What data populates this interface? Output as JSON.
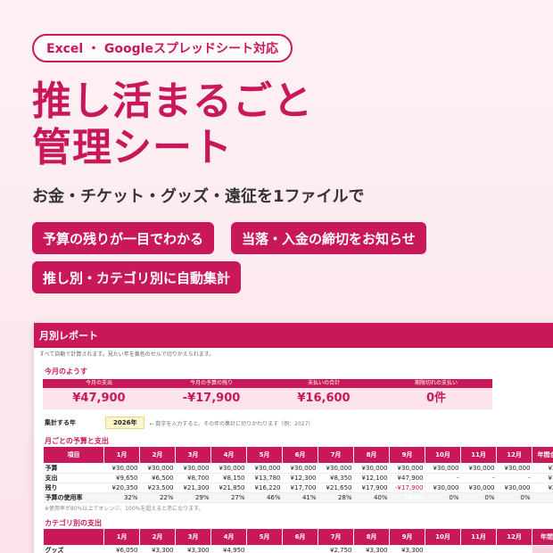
{
  "badge": "Excel ・ Googleスプレッドシート対応",
  "title_lines": [
    "推し活まるごと",
    "管理シート"
  ],
  "subtitle": "お金・チケット・グッズ・遠征を1ファイルで",
  "features": [
    "予算の残りが一目でわかる",
    "当落・入金の締切をお知らせ",
    "推し別・カテゴリ別に自動集計"
  ],
  "sheet": {
    "title": "月別レポート",
    "note": "すべて自動で計算されます。見たい年を黄色のセルで切りかえられます。",
    "summary_title": "今月のようす",
    "summary": [
      {
        "label": "今月の支出",
        "value": "¥47,900"
      },
      {
        "label": "今月の予算の残り",
        "value": "-¥17,900"
      },
      {
        "label": "未払いの合計",
        "value": "¥16,600"
      },
      {
        "label": "期限切れの支払い",
        "value": "0件"
      }
    ],
    "year_label": "集計する年",
    "year_value": "2026年",
    "year_hint": "← 数字を入力すると、その年の集計に切りかわります（例：2027）",
    "monthly_title": "月ごとの予算と支出",
    "monthly_headers": [
      "項目",
      "1月",
      "2月",
      "3月",
      "4月",
      "5月",
      "6月",
      "7月",
      "8月",
      "9月",
      "10月",
      "11月",
      "12月",
      "年間合計"
    ],
    "monthly_rows": [
      [
        "予算",
        "¥30,000",
        "¥30,000",
        "¥30,000",
        "¥30,000",
        "¥30,000",
        "¥30,000",
        "¥30,000",
        "¥30,000",
        "¥30,000",
        "¥30,000",
        "¥30,000",
        "¥30,000",
        "¥360,"
      ],
      [
        "支出",
        "¥9,650",
        "¥6,500",
        "¥8,700",
        "¥8,150",
        "¥13,780",
        "¥12,300",
        "¥8,350",
        "¥12,100",
        "¥47,900",
        "-",
        "-",
        "-",
        "¥127,"
      ],
      [
        "残り",
        "¥20,350",
        "¥23,500",
        "¥21,300",
        "¥21,850",
        "¥16,220",
        "¥17,700",
        "¥21,650",
        "¥17,900",
        "-¥17,900",
        "¥30,000",
        "¥30,000",
        "¥30,000",
        "¥232,"
      ],
      [
        "予算の使用率",
        "32%",
        "22%",
        "29%",
        "27%",
        "46%",
        "41%",
        "28%",
        "40%",
        "160%",
        "0%",
        "0%",
        "0%",
        ""
      ]
    ],
    "monthly_note": "※使用率が80%以上でオレンジ、100%を超えると赤になります。",
    "category_title": "カテゴリ別の支出",
    "category_headers": [
      "",
      "1月",
      "2月",
      "3月",
      "4月",
      "5月",
      "6月",
      "7月",
      "8月",
      "9月",
      "10月",
      "11月",
      "12月",
      "年間合"
    ],
    "category_rows": [
      [
        "グッズ",
        "¥6,050",
        "¥3,300",
        "¥3,300",
        "¥4,950",
        "",
        "",
        "¥2,750",
        "¥3,300",
        "¥3,300",
        "",
        "",
        "",
        ""
      ]
    ]
  }
}
